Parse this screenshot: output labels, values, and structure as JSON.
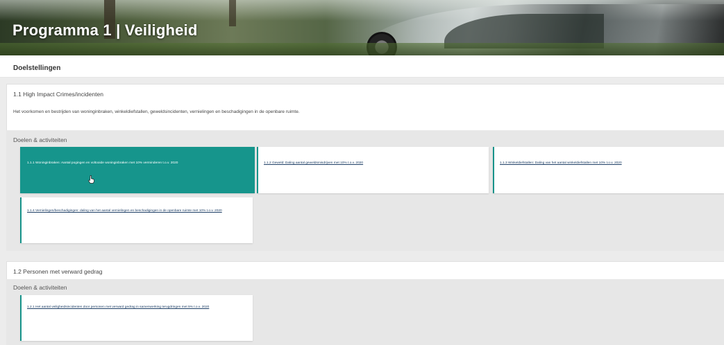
{
  "banner": {
    "title": "Programma 1 | Veiligheid"
  },
  "page": {
    "section_title": "Doelstellingen"
  },
  "goals": [
    {
      "title": "1.1 High Impact Crimes/incidenten",
      "description": "Het voorkomen en bestrijden van woninginbraken, winkeldiefstallen, geweldsincidenten, vernielingen en beschadigingen in de openbare ruimte.",
      "doelen_label": "Doelen & activiteiten",
      "cards": [
        {
          "label": "1.1.1 Woninginbraken: Aantal pogingen en voltooide woninginbraken met 10% verminderen t.o.v. 2020",
          "active": true
        },
        {
          "label": "1.1.2 Geweld: Daling aantal geweldsmisdrijven met 10% t.o.v. 2020",
          "active": false
        },
        {
          "label": "1.1.3 Winkeldiefstallen: Daling van het aantal winkeldiefstallen met 10% t.o.v. 2020",
          "active": false
        },
        {
          "label": "1.1.4 Vernielingen/beschadigingen: daling van het aantal vernielingen en beschadigingen in de openbare ruimte met 10% t.o.v. 2020",
          "active": false
        }
      ]
    },
    {
      "title": "1.2 Personen met verward gedrag",
      "doelen_label": "Doelen & activiteiten",
      "cards": [
        {
          "label": "1.2.1 Het aantal veiligheidsincidenten door personen met verward gedrag in samenwerking terugdringen met 5% t.o.v. 2020",
          "active": false
        }
      ]
    }
  ],
  "colors": {
    "accent": "#16958c",
    "link": "#1e3f66",
    "background": "#ececec"
  },
  "icons": [
    "hand-pointer-cursor-icon"
  ]
}
